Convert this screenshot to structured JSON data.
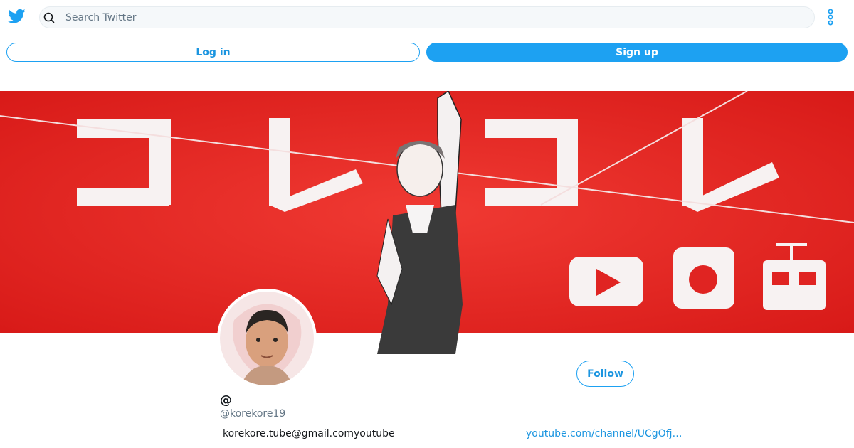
{
  "header": {
    "search": {
      "placeholder": "Search Twitter",
      "value": ""
    },
    "icons": {
      "logo": "twitter-bird-icon",
      "search": "search-icon",
      "more": "vertical-dots-icon"
    }
  },
  "auth": {
    "login_label": "Log in",
    "signup_label": "Sign up"
  },
  "banner": {
    "description_icons": [
      "play-button-icon",
      "penguin-icon",
      "robot-icon"
    ],
    "background_color": "#e8221f"
  },
  "profile": {
    "display_name": "@",
    "handle": "@korekore19",
    "follow_label": "Follow",
    "bio": "korekore.tube@gmail.comyoutube",
    "website": "youtube.com/channel/UCgOfj…"
  },
  "colors": {
    "accent": "#1da1f2",
    "link": "#1b95e0",
    "muted": "#657786"
  }
}
